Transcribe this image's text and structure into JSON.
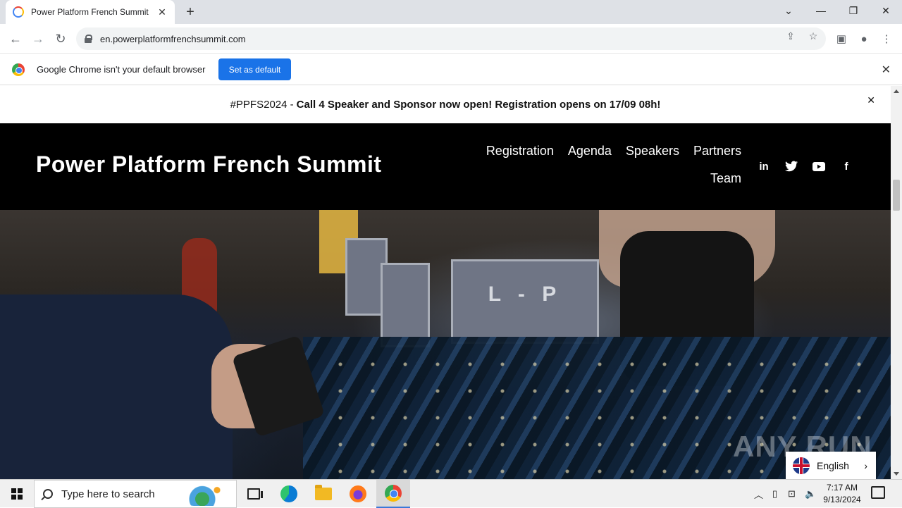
{
  "browser": {
    "tab_title": "Power Platform French Summit",
    "tab_close": "✕",
    "new_tab": "+",
    "url": "en.powerplatformfrenchsummit.com",
    "window_controls": {
      "chevron": "⌄",
      "minimize": "—",
      "restore": "❐",
      "close": "✕"
    },
    "infobar": {
      "message": "Google Chrome isn't your default browser",
      "button": "Set as default",
      "close": "✕"
    }
  },
  "page": {
    "announcement": {
      "hashtag": "#PPFS2024 -",
      "message": "Call 4 Speaker and Sponsor now open! Registration opens on 17/09 08h!",
      "close": "✕"
    },
    "brand": "Power Platform French Summit",
    "nav": [
      "Registration",
      "Agenda",
      "Speakers",
      "Partners",
      "Team"
    ],
    "socials": [
      {
        "icon": "linkedin-icon",
        "glyph": "in"
      },
      {
        "icon": "twitter-icon",
        "glyph": "🐦"
      },
      {
        "icon": "youtube-icon",
        "glyph": "▶"
      },
      {
        "icon": "facebook-icon",
        "glyph": "f"
      }
    ],
    "hero_sign": "L - P",
    "watermark": "ANY RUN",
    "language": {
      "name": "English",
      "chevron": "›"
    }
  },
  "taskbar": {
    "search_placeholder": "Type here to search",
    "time": "7:17 AM",
    "date": "9/13/2024"
  },
  "colors": {
    "header_bg": "#000000",
    "infobar_button": "#1a73e8",
    "tab_bar": "#dee1e6"
  }
}
